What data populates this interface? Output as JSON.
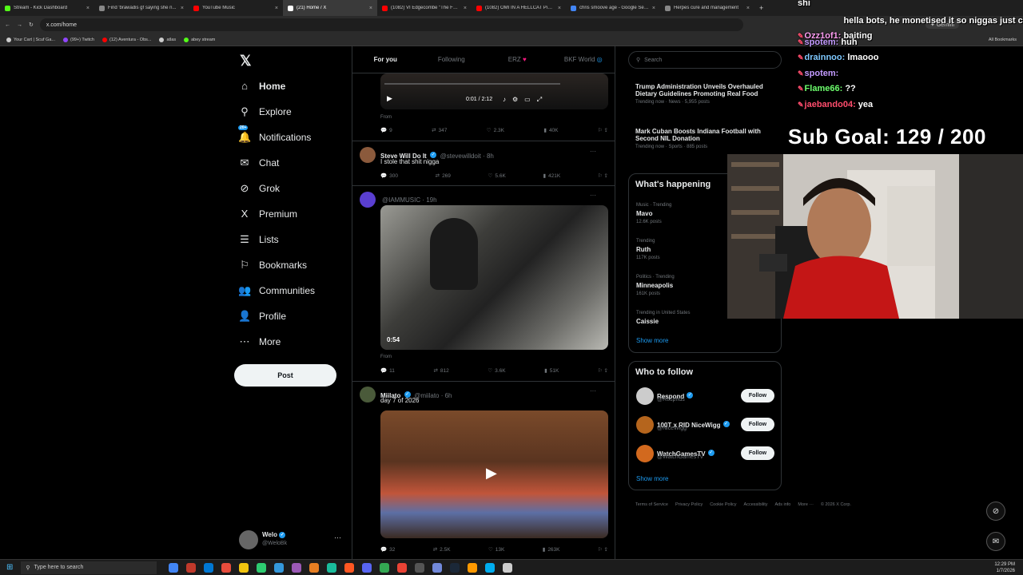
{
  "browser": {
    "tabs": [
      {
        "title": "Stream - Kick Dashboard",
        "color": "#53fc18",
        "active": false
      },
      {
        "title": "Find 'brawadis gf saying she n...",
        "color": "#888888",
        "active": false
      },
      {
        "title": "YouTube Music",
        "color": "#ff0000",
        "active": false
      },
      {
        "title": "(21) Home / X",
        "color": "#ffffff",
        "active": true
      },
      {
        "title": "(1082) VI Edgecombe \"The Fut...",
        "color": "#ff0000",
        "active": false
      },
      {
        "title": "(1082) OMI IN A HELLCAT Pisan...",
        "color": "#ff0000",
        "active": false
      },
      {
        "title": "chris smoove age - Google Sea...",
        "color": "#4285f4",
        "active": false
      },
      {
        "title": "Herpes cure and management",
        "color": "#888888",
        "active": false
      }
    ],
    "url": "x.com/home",
    "bookmarks": [
      {
        "label": "Your Cart | Scuf Ga...",
        "color": "#cccccc"
      },
      {
        "label": "(99+) Twitch",
        "color": "#9146ff"
      },
      {
        "label": "(12) Aventura - Obs...",
        "color": "#ff0000"
      },
      {
        "label": "atlas",
        "color": "#cccccc"
      },
      {
        "label": "abey stream",
        "color": "#53fc18"
      }
    ],
    "all_bookmarks": "All Bookmarks",
    "gemini": "Gemini"
  },
  "nav": {
    "items": [
      {
        "label": "Home",
        "icon": "⌂"
      },
      {
        "label": "Explore",
        "icon": "⚲"
      },
      {
        "label": "Notifications",
        "icon": "🔔"
      },
      {
        "label": "Chat",
        "icon": "✉"
      },
      {
        "label": "Grok",
        "icon": "⊘"
      },
      {
        "label": "Premium",
        "icon": "X"
      },
      {
        "label": "Lists",
        "icon": "☰"
      },
      {
        "label": "Bookmarks",
        "icon": "⚐"
      },
      {
        "label": "Communities",
        "icon": "👥"
      },
      {
        "label": "Profile",
        "icon": "👤"
      },
      {
        "label": "More",
        "icon": "⋯"
      }
    ],
    "notif_badge": "20+",
    "post_label": "Post",
    "account": {
      "name": "Welo",
      "handle": "@WeloBk"
    }
  },
  "feed": {
    "tabs": [
      "For you",
      "Following",
      "ERZ",
      "BKF World"
    ],
    "video_time": "0:01 / 2:12",
    "posts": [
      {
        "from": "From",
        "replies": "9",
        "reposts": "347",
        "likes": "2.3K",
        "views": "40K"
      },
      {
        "name": "Steve Will Do It",
        "handle": "@stevewilldoit · 8h",
        "text": "I stole that shit nigga",
        "replies": "300",
        "reposts": "269",
        "likes": "5.6K",
        "views": "421K"
      },
      {
        "handle": "@IAMMUSIC · 19h",
        "duration": "0:54",
        "from": "From",
        "replies": "11",
        "reposts": "812",
        "likes": "3.6K",
        "views": "51K"
      },
      {
        "name": "Miilato",
        "handle": "@miilato · 6h",
        "text": "day 7 of 2026",
        "replies": "32",
        "reposts": "2.5K",
        "likes": "13K",
        "views": "263K"
      }
    ]
  },
  "right": {
    "search_placeholder": "Search",
    "news": [
      {
        "title": "Trump Administration Unveils Overhauled Dietary Guidelines Promoting Real Food",
        "meta": "Trending now · News · 5,955 posts"
      },
      {
        "title": "Mark Cuban Boosts Indiana Football with Second NIL Donation",
        "meta": "Trending now · Sports · 885 posts"
      }
    ],
    "happening_title": "What's happening",
    "trends": [
      {
        "meta": "Music · Trending",
        "name": "Mavo",
        "posts": "12.6K posts"
      },
      {
        "meta": "Trending",
        "name": "Ruth",
        "posts": "117K posts"
      },
      {
        "meta": "Politics · Trending",
        "name": "Minneapolis",
        "posts": "161K posts"
      },
      {
        "meta": "Trending in United States",
        "name": "Caissie",
        "posts": ""
      }
    ],
    "show_more": "Show more",
    "who_title": "Who to follow",
    "follow_label": "Follow",
    "suggestions": [
      {
        "name": "Respond",
        "handle": "@Respnds",
        "color": "#cccccc"
      },
      {
        "name": "100T x RID NiceWigg",
        "handle": "@NiceWigg",
        "color": "#b5651d"
      },
      {
        "name": "WatchGamesTV",
        "handle": "@WatchGamesTV",
        "color": "#d2691e"
      }
    ],
    "footer": [
      "Terms of Service",
      "Privacy Policy",
      "Cookie Policy",
      "Accessibility",
      "Ads info",
      "More ···",
      "© 2026 X Corp."
    ]
  },
  "overlay": {
    "chat": [
      {
        "user": "",
        "msg": "shi",
        "color": "#ffffff"
      },
      {
        "user": "Ozz1of1:",
        "msg": "hella bots, he monetised it so niggas just clip baiting",
        "color": "#ff9ff3"
      },
      {
        "user": "spotem:",
        "msg": "huh",
        "color": "#c39bff"
      },
      {
        "user": "drainnoo:",
        "msg": "lmaooo",
        "color": "#7ec8ff"
      },
      {
        "user": "spotem:",
        "msg": "",
        "color": "#c39bff"
      },
      {
        "user": "Flame66:",
        "msg": "??",
        "color": "#6dff6d"
      },
      {
        "user": "jaebando04:",
        "msg": "yea",
        "color": "#ff4d6d"
      }
    ],
    "sub_goal": "Sub Goal:  129 / 200"
  },
  "taskbar": {
    "search_placeholder": "Type here to search",
    "time": "12:29 PM",
    "date": "1/7/2026"
  }
}
